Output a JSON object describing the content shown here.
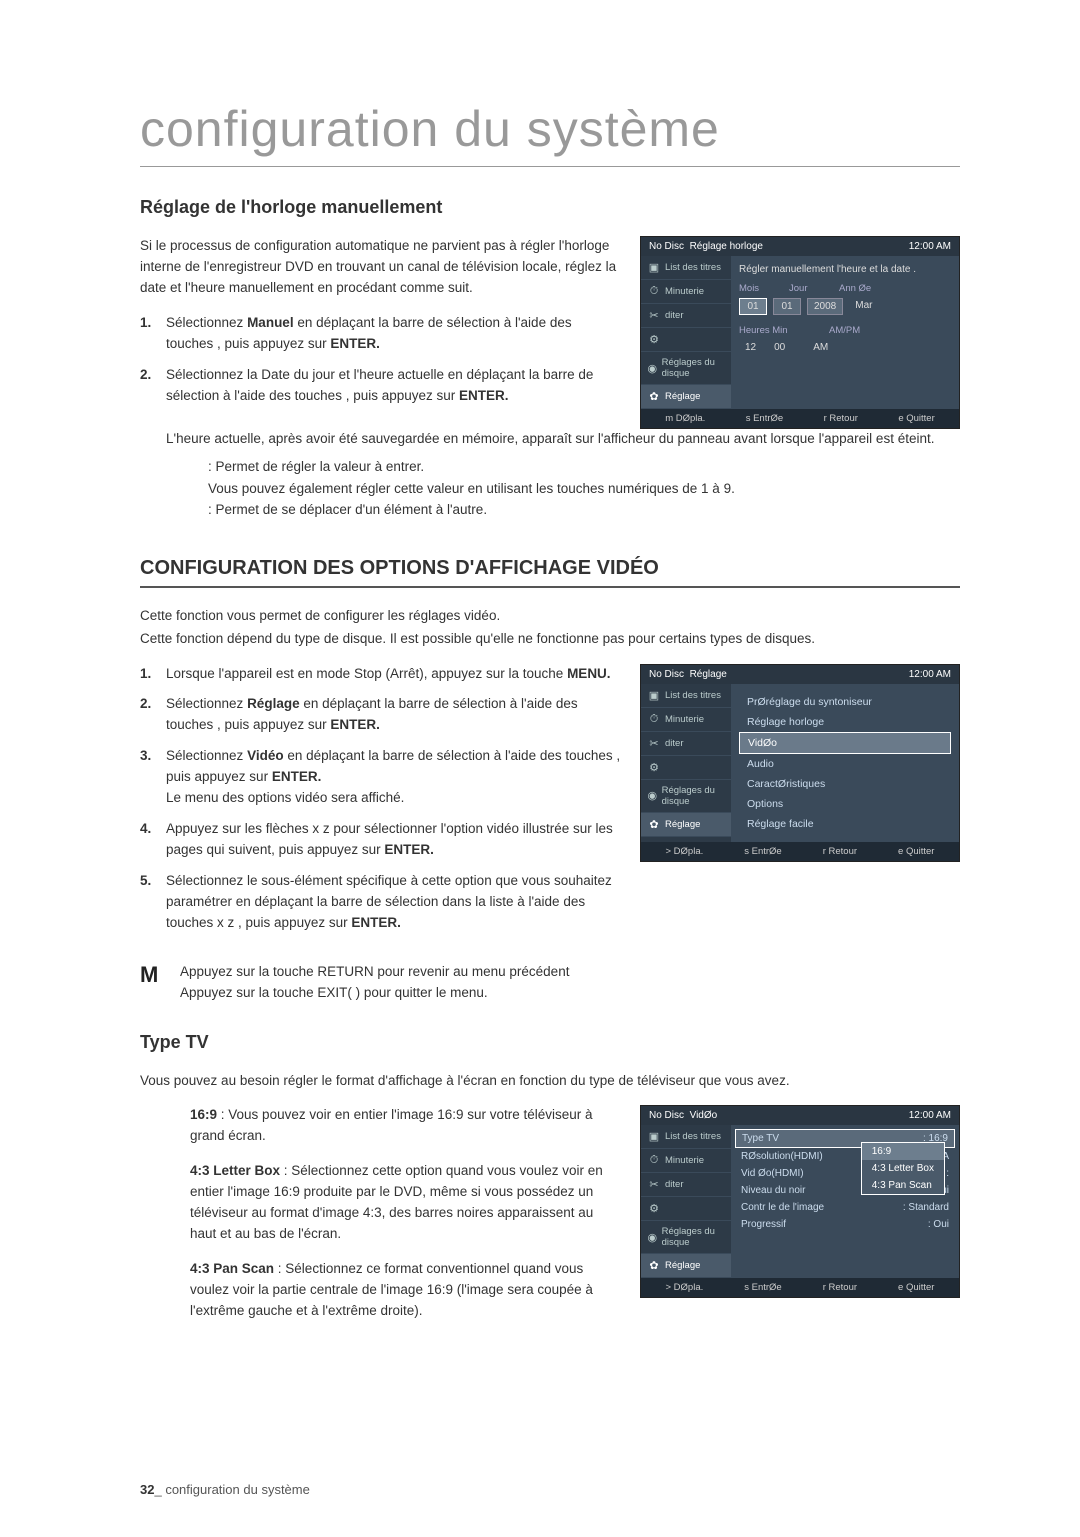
{
  "title": "configuration du système",
  "section1": {
    "heading": "Réglage de l'horloge manuellement",
    "intro": "Si le processus de configuration automatique ne parvient pas à régler l'horloge interne de l'enregistreur DVD en trouvant un canal de télévision locale, réglez la date et l'heure manuellement en procédant comme suit.",
    "step1_a": "Sélectionnez ",
    "step1_b": "Manuel",
    "step1_c": " en déplaçant la barre de sélection à l'aide des touches      , puis appuyez sur ",
    "step1_d": "ENTER.",
    "step2_a": "Sélectionnez la Date du jour et l'heure actuelle en déplaçant la barre de sélection à l'aide des touches             , puis appuyez sur ",
    "step2_b": "ENTER.",
    "after": "L'heure actuelle, après avoir été sauvegardée en mémoire, apparaît sur l'afficheur du panneau avant lorsque l'appareil est éteint.",
    "bullet1": ": Permet de régler la valeur à entrer.",
    "bullet1b": "Vous pouvez également régler cette valeur en utilisant les touches numériques de 1 à 9.",
    "bullet2": ": Permet de se déplacer d'un élément à l'autre."
  },
  "section2": {
    "heading": "CONFIGURATION DES OPTIONS D'AFFICHAGE VIDÉO",
    "intro1": "Cette fonction vous permet de configurer les réglages vidéo.",
    "intro2": "Cette fonction dépend du type de disque. Il est possible qu'elle ne fonctionne pas pour certains types de disques.",
    "step1_a": "Lorsque l'appareil est en mode Stop (Arrêt),  appuyez sur la touche ",
    "step1_b": "MENU.",
    "step2_a": "Sélectionnez ",
    "step2_b": "Réglage",
    "step2_c": " en déplaçant la barre de sélection à l'aide des touches      , puis appuyez sur ",
    "step2_d": "ENTER.",
    "step3_a": "Sélectionnez ",
    "step3_b": "Vidéo",
    "step3_c": " en déplaçant la barre de sélection à l'aide des touches      , puis appuyez sur ",
    "step3_d": "ENTER.",
    "step3_e": "Le menu des options vidéo sera affiché.",
    "step4_a": "Appuyez sur les flèches  x z  pour sélectionner l'option vidéo illustrée sur les pages qui suivent, puis appuyez sur ",
    "step4_b": "ENTER.",
    "step5_a": "Sélectionnez le sous-élément spécifique à cette option que vous souhaitez paramétrer en déplaçant la barre de sélection dans la liste à l'aide des touches  x z , puis appuyez sur ",
    "step5_b": "ENTER.",
    "note1": "Appuyez sur la touche RETURN pour revenir au menu précédent",
    "note2": "Appuyez sur la touche EXIT(   ) pour quitter le menu."
  },
  "section3": {
    "heading": "Type TV",
    "intro": "Vous pouvez au besoin régler le format d'affichage à l'écran en fonction du type de téléviseur que vous avez.",
    "opt1_label": "16:9",
    "opt1_text": " : Vous pouvez voir en entier l'image 16:9 sur votre téléviseur à grand écran.",
    "opt2_label": "4:3 Letter Box",
    "opt2_text": " : Sélectionnez cette option quand vous voulez voir en entier l'image 16:9 produite par le DVD, même si vous possédez un téléviseur au format d'image 4:3, des barres noires apparaissent au haut et au bas de l'écran.",
    "opt3_label": "4:3 Pan Scan",
    "opt3_text": " : Sélectionnez ce format conventionnel quand vous voulez voir la partie centrale de l'image 16:9 (l'image sera coupée à l'extrême gauche et à l'extrême droite)."
  },
  "osd_sidebar": [
    {
      "icon": "▣",
      "label": "List des titres"
    },
    {
      "icon": "⏱",
      "label": "Minuterie"
    },
    {
      "icon": "✂",
      "label": "diter"
    },
    {
      "icon": "⚙",
      "label": ""
    },
    {
      "icon": "◉",
      "label": "Réglages du disque"
    },
    {
      "icon": "✿",
      "label": "Réglage"
    }
  ],
  "osd1": {
    "no_disc": "No Disc",
    "crumb": "Réglage horloge",
    "time": "12:00 AM",
    "instruction": "Régler manuellement l'heure et la date  .",
    "labels": {
      "mois": "Mois",
      "jour": "Jour",
      "ann": "Ann Øe"
    },
    "vals": {
      "mois": "01",
      "jour": "01",
      "ann": "2008",
      "dow": "Mar"
    },
    "labels2": {
      "hm": "Heures Min",
      "ampm": "AM/PM"
    },
    "vals2": {
      "h": "12",
      "m": "00",
      "ampm": "AM"
    },
    "footer": {
      "a": "m  DØpla.",
      "b": "s  EntrØe",
      "c": "r  Retour",
      "d": "e  Quitter"
    }
  },
  "osd2": {
    "no_disc": "No Disc",
    "crumb": "Réglage",
    "time": "12:00 AM",
    "items": [
      "PrØréglage du syntoniseur",
      "Réglage horloge",
      "VidØo",
      "Audio",
      "CaractØristiques",
      "Options",
      "Réglage facile"
    ],
    "active_index": 2,
    "footer": {
      "a": ">  DØpla.",
      "b": "s  EntrØe",
      "c": "r  Retour",
      "d": "e  Quitter"
    }
  },
  "osd3": {
    "no_disc": "No Disc",
    "crumb": "VidØo",
    "time": "12:00 AM",
    "rows": [
      {
        "k": "Type TV",
        "v": ": 16:9"
      },
      {
        "k": "RØsolution(HDMI)",
        "v": ": A"
      },
      {
        "k": "Vid Øo(HDMI)",
        "v": ": "
      },
      {
        "k": "Niveau du noir",
        "v": ": Oui"
      },
      {
        "k": "Contr le de l'image",
        "v": ": Standard"
      },
      {
        "k": "Progressif",
        "v": ": Oui"
      }
    ],
    "sub": [
      "16:9",
      "4:3 Letter Box",
      "4:3 Pan Scan"
    ],
    "footer": {
      "a": ">  DØpla.",
      "b": "s  EntrØe",
      "c": "r  Retour",
      "d": "e  Quitter"
    }
  },
  "footer": {
    "num": "32",
    "sep": "_",
    "text": " configuration du système"
  }
}
